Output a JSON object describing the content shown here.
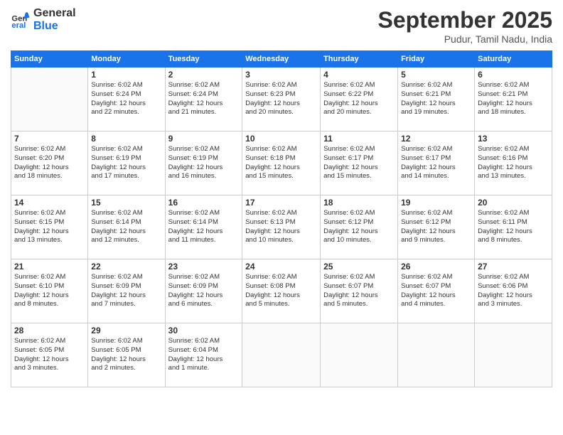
{
  "header": {
    "logo_line1": "General",
    "logo_line2": "Blue",
    "month": "September 2025",
    "location": "Pudur, Tamil Nadu, India"
  },
  "days_of_week": [
    "Sunday",
    "Monday",
    "Tuesday",
    "Wednesday",
    "Thursday",
    "Friday",
    "Saturday"
  ],
  "weeks": [
    [
      {
        "day": "",
        "info": ""
      },
      {
        "day": "1",
        "info": "Sunrise: 6:02 AM\nSunset: 6:24 PM\nDaylight: 12 hours\nand 22 minutes."
      },
      {
        "day": "2",
        "info": "Sunrise: 6:02 AM\nSunset: 6:24 PM\nDaylight: 12 hours\nand 21 minutes."
      },
      {
        "day": "3",
        "info": "Sunrise: 6:02 AM\nSunset: 6:23 PM\nDaylight: 12 hours\nand 20 minutes."
      },
      {
        "day": "4",
        "info": "Sunrise: 6:02 AM\nSunset: 6:22 PM\nDaylight: 12 hours\nand 20 minutes."
      },
      {
        "day": "5",
        "info": "Sunrise: 6:02 AM\nSunset: 6:21 PM\nDaylight: 12 hours\nand 19 minutes."
      },
      {
        "day": "6",
        "info": "Sunrise: 6:02 AM\nSunset: 6:21 PM\nDaylight: 12 hours\nand 18 minutes."
      }
    ],
    [
      {
        "day": "7",
        "info": "Sunrise: 6:02 AM\nSunset: 6:20 PM\nDaylight: 12 hours\nand 18 minutes."
      },
      {
        "day": "8",
        "info": "Sunrise: 6:02 AM\nSunset: 6:19 PM\nDaylight: 12 hours\nand 17 minutes."
      },
      {
        "day": "9",
        "info": "Sunrise: 6:02 AM\nSunset: 6:19 PM\nDaylight: 12 hours\nand 16 minutes."
      },
      {
        "day": "10",
        "info": "Sunrise: 6:02 AM\nSunset: 6:18 PM\nDaylight: 12 hours\nand 15 minutes."
      },
      {
        "day": "11",
        "info": "Sunrise: 6:02 AM\nSunset: 6:17 PM\nDaylight: 12 hours\nand 15 minutes."
      },
      {
        "day": "12",
        "info": "Sunrise: 6:02 AM\nSunset: 6:17 PM\nDaylight: 12 hours\nand 14 minutes."
      },
      {
        "day": "13",
        "info": "Sunrise: 6:02 AM\nSunset: 6:16 PM\nDaylight: 12 hours\nand 13 minutes."
      }
    ],
    [
      {
        "day": "14",
        "info": "Sunrise: 6:02 AM\nSunset: 6:15 PM\nDaylight: 12 hours\nand 13 minutes."
      },
      {
        "day": "15",
        "info": "Sunrise: 6:02 AM\nSunset: 6:14 PM\nDaylight: 12 hours\nand 12 minutes."
      },
      {
        "day": "16",
        "info": "Sunrise: 6:02 AM\nSunset: 6:14 PM\nDaylight: 12 hours\nand 11 minutes."
      },
      {
        "day": "17",
        "info": "Sunrise: 6:02 AM\nSunset: 6:13 PM\nDaylight: 12 hours\nand 10 minutes."
      },
      {
        "day": "18",
        "info": "Sunrise: 6:02 AM\nSunset: 6:12 PM\nDaylight: 12 hours\nand 10 minutes."
      },
      {
        "day": "19",
        "info": "Sunrise: 6:02 AM\nSunset: 6:12 PM\nDaylight: 12 hours\nand 9 minutes."
      },
      {
        "day": "20",
        "info": "Sunrise: 6:02 AM\nSunset: 6:11 PM\nDaylight: 12 hours\nand 8 minutes."
      }
    ],
    [
      {
        "day": "21",
        "info": "Sunrise: 6:02 AM\nSunset: 6:10 PM\nDaylight: 12 hours\nand 8 minutes."
      },
      {
        "day": "22",
        "info": "Sunrise: 6:02 AM\nSunset: 6:09 PM\nDaylight: 12 hours\nand 7 minutes."
      },
      {
        "day": "23",
        "info": "Sunrise: 6:02 AM\nSunset: 6:09 PM\nDaylight: 12 hours\nand 6 minutes."
      },
      {
        "day": "24",
        "info": "Sunrise: 6:02 AM\nSunset: 6:08 PM\nDaylight: 12 hours\nand 5 minutes."
      },
      {
        "day": "25",
        "info": "Sunrise: 6:02 AM\nSunset: 6:07 PM\nDaylight: 12 hours\nand 5 minutes."
      },
      {
        "day": "26",
        "info": "Sunrise: 6:02 AM\nSunset: 6:07 PM\nDaylight: 12 hours\nand 4 minutes."
      },
      {
        "day": "27",
        "info": "Sunrise: 6:02 AM\nSunset: 6:06 PM\nDaylight: 12 hours\nand 3 minutes."
      }
    ],
    [
      {
        "day": "28",
        "info": "Sunrise: 6:02 AM\nSunset: 6:05 PM\nDaylight: 12 hours\nand 3 minutes."
      },
      {
        "day": "29",
        "info": "Sunrise: 6:02 AM\nSunset: 6:05 PM\nDaylight: 12 hours\nand 2 minutes."
      },
      {
        "day": "30",
        "info": "Sunrise: 6:02 AM\nSunset: 6:04 PM\nDaylight: 12 hours\nand 1 minute."
      },
      {
        "day": "",
        "info": ""
      },
      {
        "day": "",
        "info": ""
      },
      {
        "day": "",
        "info": ""
      },
      {
        "day": "",
        "info": ""
      }
    ]
  ]
}
